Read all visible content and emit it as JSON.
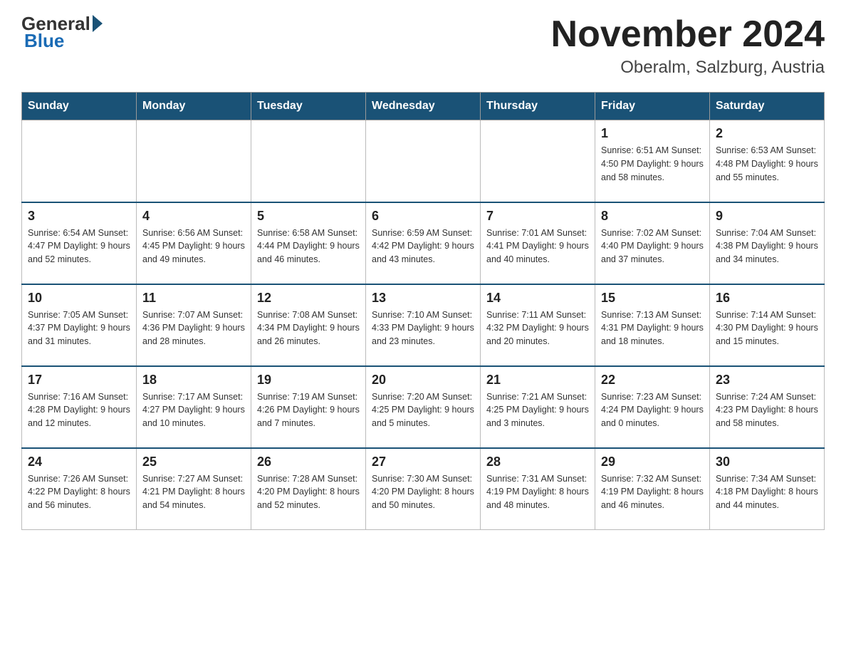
{
  "logo": {
    "general": "General",
    "blue": "Blue"
  },
  "title": "November 2024",
  "location": "Oberalm, Salzburg, Austria",
  "weekdays": [
    "Sunday",
    "Monday",
    "Tuesday",
    "Wednesday",
    "Thursday",
    "Friday",
    "Saturday"
  ],
  "weeks": [
    [
      {
        "day": "",
        "info": ""
      },
      {
        "day": "",
        "info": ""
      },
      {
        "day": "",
        "info": ""
      },
      {
        "day": "",
        "info": ""
      },
      {
        "day": "",
        "info": ""
      },
      {
        "day": "1",
        "info": "Sunrise: 6:51 AM\nSunset: 4:50 PM\nDaylight: 9 hours\nand 58 minutes."
      },
      {
        "day": "2",
        "info": "Sunrise: 6:53 AM\nSunset: 4:48 PM\nDaylight: 9 hours\nand 55 minutes."
      }
    ],
    [
      {
        "day": "3",
        "info": "Sunrise: 6:54 AM\nSunset: 4:47 PM\nDaylight: 9 hours\nand 52 minutes."
      },
      {
        "day": "4",
        "info": "Sunrise: 6:56 AM\nSunset: 4:45 PM\nDaylight: 9 hours\nand 49 minutes."
      },
      {
        "day": "5",
        "info": "Sunrise: 6:58 AM\nSunset: 4:44 PM\nDaylight: 9 hours\nand 46 minutes."
      },
      {
        "day": "6",
        "info": "Sunrise: 6:59 AM\nSunset: 4:42 PM\nDaylight: 9 hours\nand 43 minutes."
      },
      {
        "day": "7",
        "info": "Sunrise: 7:01 AM\nSunset: 4:41 PM\nDaylight: 9 hours\nand 40 minutes."
      },
      {
        "day": "8",
        "info": "Sunrise: 7:02 AM\nSunset: 4:40 PM\nDaylight: 9 hours\nand 37 minutes."
      },
      {
        "day": "9",
        "info": "Sunrise: 7:04 AM\nSunset: 4:38 PM\nDaylight: 9 hours\nand 34 minutes."
      }
    ],
    [
      {
        "day": "10",
        "info": "Sunrise: 7:05 AM\nSunset: 4:37 PM\nDaylight: 9 hours\nand 31 minutes."
      },
      {
        "day": "11",
        "info": "Sunrise: 7:07 AM\nSunset: 4:36 PM\nDaylight: 9 hours\nand 28 minutes."
      },
      {
        "day": "12",
        "info": "Sunrise: 7:08 AM\nSunset: 4:34 PM\nDaylight: 9 hours\nand 26 minutes."
      },
      {
        "day": "13",
        "info": "Sunrise: 7:10 AM\nSunset: 4:33 PM\nDaylight: 9 hours\nand 23 minutes."
      },
      {
        "day": "14",
        "info": "Sunrise: 7:11 AM\nSunset: 4:32 PM\nDaylight: 9 hours\nand 20 minutes."
      },
      {
        "day": "15",
        "info": "Sunrise: 7:13 AM\nSunset: 4:31 PM\nDaylight: 9 hours\nand 18 minutes."
      },
      {
        "day": "16",
        "info": "Sunrise: 7:14 AM\nSunset: 4:30 PM\nDaylight: 9 hours\nand 15 minutes."
      }
    ],
    [
      {
        "day": "17",
        "info": "Sunrise: 7:16 AM\nSunset: 4:28 PM\nDaylight: 9 hours\nand 12 minutes."
      },
      {
        "day": "18",
        "info": "Sunrise: 7:17 AM\nSunset: 4:27 PM\nDaylight: 9 hours\nand 10 minutes."
      },
      {
        "day": "19",
        "info": "Sunrise: 7:19 AM\nSunset: 4:26 PM\nDaylight: 9 hours\nand 7 minutes."
      },
      {
        "day": "20",
        "info": "Sunrise: 7:20 AM\nSunset: 4:25 PM\nDaylight: 9 hours\nand 5 minutes."
      },
      {
        "day": "21",
        "info": "Sunrise: 7:21 AM\nSunset: 4:25 PM\nDaylight: 9 hours\nand 3 minutes."
      },
      {
        "day": "22",
        "info": "Sunrise: 7:23 AM\nSunset: 4:24 PM\nDaylight: 9 hours\nand 0 minutes."
      },
      {
        "day": "23",
        "info": "Sunrise: 7:24 AM\nSunset: 4:23 PM\nDaylight: 8 hours\nand 58 minutes."
      }
    ],
    [
      {
        "day": "24",
        "info": "Sunrise: 7:26 AM\nSunset: 4:22 PM\nDaylight: 8 hours\nand 56 minutes."
      },
      {
        "day": "25",
        "info": "Sunrise: 7:27 AM\nSunset: 4:21 PM\nDaylight: 8 hours\nand 54 minutes."
      },
      {
        "day": "26",
        "info": "Sunrise: 7:28 AM\nSunset: 4:20 PM\nDaylight: 8 hours\nand 52 minutes."
      },
      {
        "day": "27",
        "info": "Sunrise: 7:30 AM\nSunset: 4:20 PM\nDaylight: 8 hours\nand 50 minutes."
      },
      {
        "day": "28",
        "info": "Sunrise: 7:31 AM\nSunset: 4:19 PM\nDaylight: 8 hours\nand 48 minutes."
      },
      {
        "day": "29",
        "info": "Sunrise: 7:32 AM\nSunset: 4:19 PM\nDaylight: 8 hours\nand 46 minutes."
      },
      {
        "day": "30",
        "info": "Sunrise: 7:34 AM\nSunset: 4:18 PM\nDaylight: 8 hours\nand 44 minutes."
      }
    ]
  ]
}
